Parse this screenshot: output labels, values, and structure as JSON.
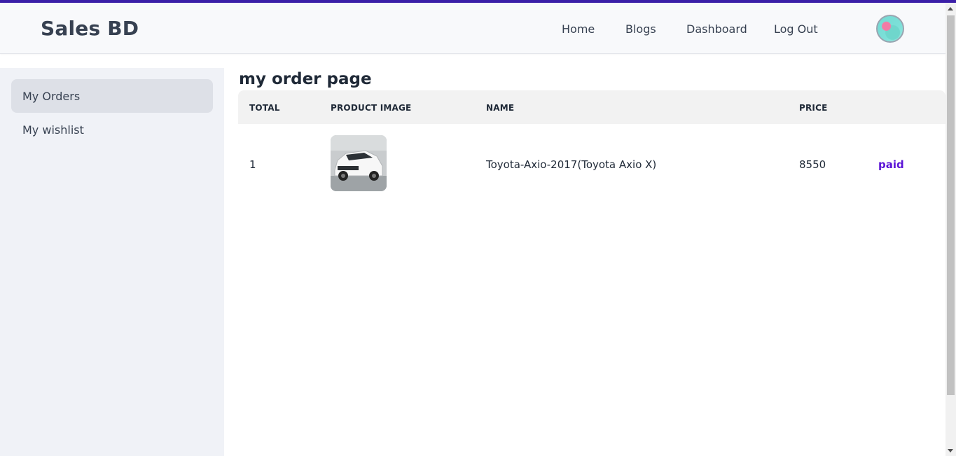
{
  "navbar": {
    "brand": "Sales BD",
    "links": [
      "Home",
      "Blogs",
      "Dashboard",
      "Log Out"
    ],
    "accent_color": "#3b1fa8"
  },
  "sidebar": {
    "items": [
      {
        "label": "My Orders",
        "active": true
      },
      {
        "label": "My wishlist",
        "active": false
      }
    ]
  },
  "main": {
    "title": "my order page",
    "table": {
      "headers": [
        "TOTAL",
        "PRODUCT IMAGE",
        "NAME",
        "PRICE"
      ],
      "rows": [
        {
          "total": "1",
          "image_icon": "car-thumbnail",
          "name": "Toyota-Axio-2017(Toyota Axio X)",
          "price": "8550",
          "status": "paid"
        }
      ]
    },
    "status_color": "#5b14d6"
  }
}
